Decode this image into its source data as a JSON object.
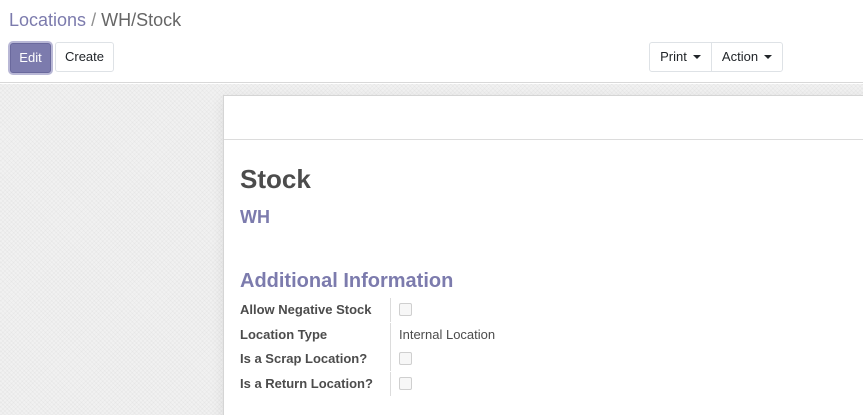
{
  "breadcrumb": {
    "parent": "Locations",
    "separator": "/",
    "current": "WH/Stock"
  },
  "toolbar": {
    "edit_label": "Edit",
    "create_label": "Create",
    "print_label": "Print",
    "action_label": "Action"
  },
  "colors": {
    "primary": "#7c7bad",
    "text": "#4c4c4c"
  },
  "form": {
    "name": "Stock",
    "parent_location": "WH",
    "section_title": "Additional Information",
    "fields": [
      {
        "label": "Allow Negative Stock",
        "type": "checkbox",
        "checked": false
      },
      {
        "label": "Location Type",
        "type": "text",
        "value": "Internal Location"
      },
      {
        "label": "Is a Scrap Location?",
        "type": "checkbox",
        "checked": false
      },
      {
        "label": "Is a Return Location?",
        "type": "checkbox",
        "checked": false
      }
    ]
  }
}
